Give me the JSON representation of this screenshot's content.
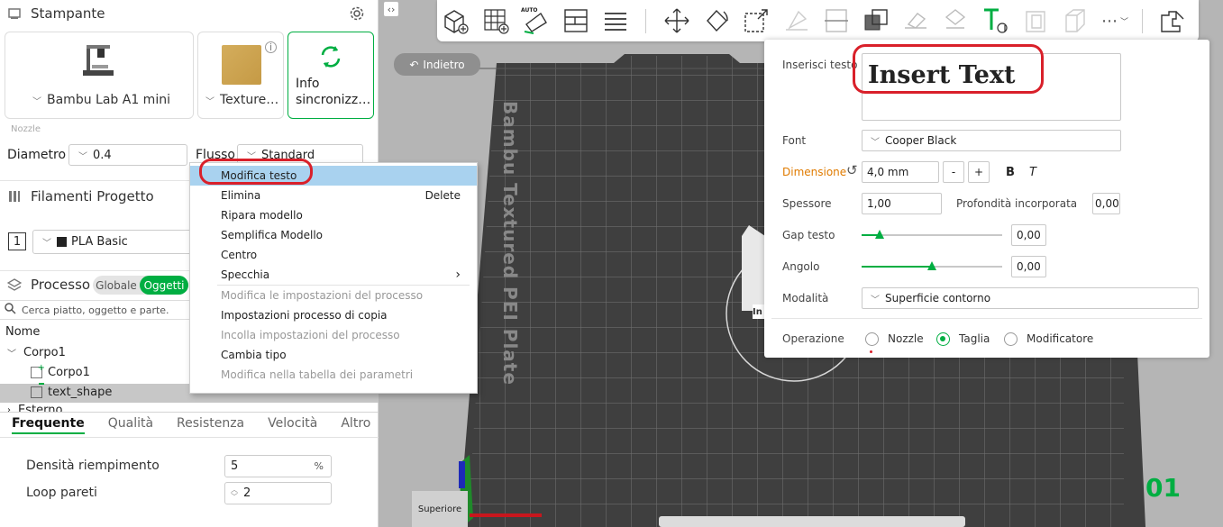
{
  "left_panel": {
    "printer": {
      "title": "Stampante",
      "printer_name": "Bambu Lab A1 mini",
      "plate_name": "Texture…",
      "sync_label_1": "Info",
      "sync_label_2": "sincronizz…",
      "nozzle_section": "Nozzle",
      "diameter_label": "Diametro",
      "diameter_value": "0.4",
      "flow_label": "Flusso",
      "flow_value": "Standard"
    },
    "filaments": {
      "title": "Filamenti Progetto",
      "slot_number": "1",
      "filament_name": "PLA Basic"
    },
    "process": {
      "title": "Processo",
      "toggle_global": "Globale",
      "toggle_objects": "Oggetti",
      "search_placeholder": "Cerca piatto, oggetto e parte.",
      "name_header": "Nome",
      "tree": [
        {
          "label": "Corpo1"
        },
        {
          "label": "Corpo1"
        },
        {
          "label": "text_shape"
        },
        {
          "label": "Esterno"
        }
      ]
    },
    "tabs": [
      "Frequente",
      "Qualità",
      "Resistenza",
      "Velocità",
      "Altro"
    ],
    "settings": {
      "infill_label": "Densità riempimento",
      "infill_value": "5",
      "infill_unit": "%",
      "walls_label": "Loop pareti",
      "walls_value": "2"
    }
  },
  "context_menu": {
    "items": [
      {
        "label": "Modifica testo",
        "shortcut": "",
        "state": "highlighted"
      },
      {
        "label": "Elimina",
        "shortcut": "Delete",
        "state": "enabled"
      },
      {
        "label": "Ripara modello",
        "shortcut": "",
        "state": "enabled"
      },
      {
        "label": "Semplifica Modello",
        "shortcut": "",
        "state": "enabled"
      },
      {
        "label": "Centro",
        "shortcut": "",
        "state": "enabled"
      },
      {
        "label": "Specchia",
        "shortcut": "›",
        "state": "enabled"
      },
      {
        "label": "Modifica le impostazioni del processo",
        "shortcut": "",
        "state": "disabled"
      },
      {
        "label": "Impostazioni processo di copia",
        "shortcut": "",
        "state": "enabled"
      },
      {
        "label": "Incolla impostazioni del processo",
        "shortcut": "",
        "state": "disabled"
      },
      {
        "label": "Cambia tipo",
        "shortcut": "",
        "state": "enabled"
      },
      {
        "label": "Modifica nella tabella dei parametri",
        "shortcut": "",
        "state": "disabled"
      }
    ]
  },
  "viewport": {
    "back_button": "Indietro",
    "plate_text": "Bambu Textured PEI Plate",
    "view_label": "Superiore",
    "plate_number": "01",
    "object_label": "In"
  },
  "text_panel": {
    "insert_label": "Inserisci testo",
    "insert_value": "Insert Text",
    "font_label": "Font",
    "font_value": "Cooper Black",
    "size_label": "Dimensione",
    "size_value": "4,0 mm",
    "minus": "-",
    "plus": "+",
    "bold": "B",
    "italic": "T",
    "thickness_label": "Spessore",
    "thickness_value": "1,00",
    "embed_label": "Profondità incorporata",
    "embed_value": "0,00",
    "gap_label": "Gap testo",
    "gap_value": "0,00",
    "angle_label": "Angolo",
    "angle_value": "0,00",
    "mode_label": "Modalità",
    "mode_value": "Superficie contorno",
    "operation_label": "Operazione",
    "op_nozzle": "Nozzle",
    "op_cut": "Taglia",
    "op_modifier": "Modificatore",
    "selected_operation": "Taglia"
  },
  "toolbar": {
    "auto_label": "AUTO",
    "more_label": "⋯"
  },
  "colors": {
    "accent": "#00ae42",
    "highlight": "#a9d2ef",
    "annotation": "#d9202a"
  }
}
